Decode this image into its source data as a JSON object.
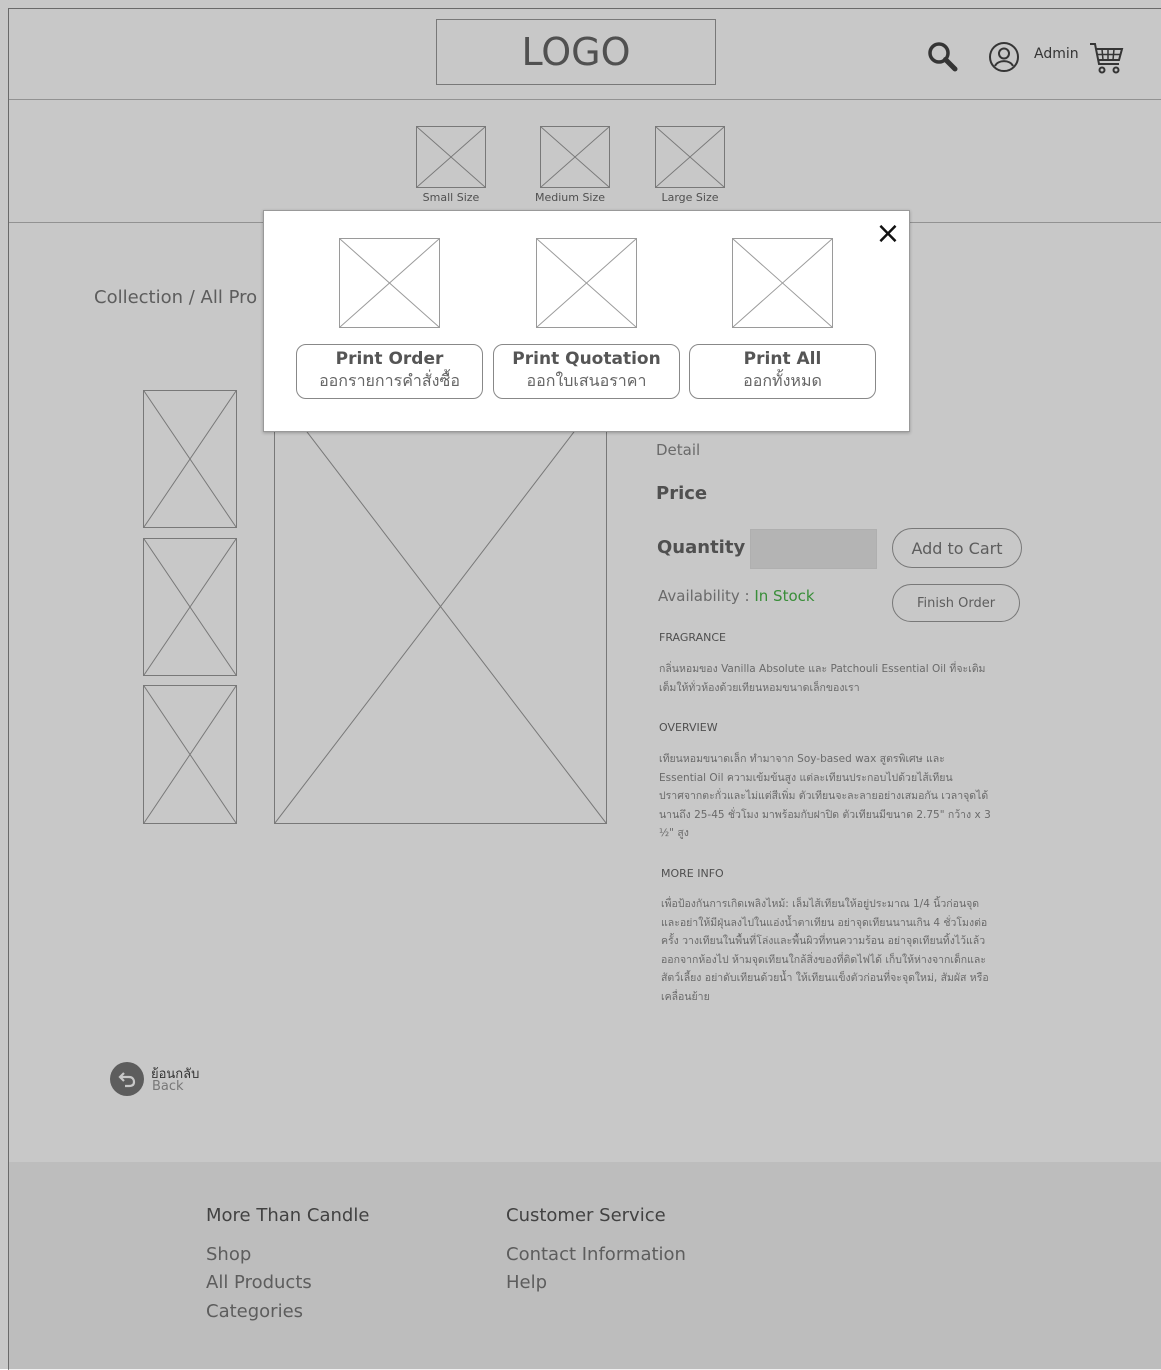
{
  "header": {
    "logo": "LOGO",
    "user_label": "Admin"
  },
  "sizes": [
    {
      "label": "Small Size"
    },
    {
      "label": "Medium Size"
    },
    {
      "label": "Large Size"
    }
  ],
  "breadcrumb": "Collection / All Pro",
  "product": {
    "detail": "Detail",
    "price": "Price",
    "quantity_label": "Quantity",
    "add_to_cart": "Add to Cart",
    "availability_label": "Availability : ",
    "availability_value": "In Stock",
    "finish_order": "Finish Order",
    "fragrance_h": "FRAGRANCE",
    "fragrance_t": "กลิ่นหอมของ Vanilla Absolute และ Patchouli Essential Oil ที่จะเติมเต็มให้ทั่วห้องด้วยเทียนหอมขนาดเล็กของเรา",
    "overview_h": "OVERVIEW",
    "overview_t": "เทียนหอมขนาดเล็ก ทำมาจาก Soy-based wax สูตรพิเศษ และ Essential Oil ความเข้มข้นสูง แต่ละเทียนประกอบไปด้วยไส้เทียนปราศจากตะกั่วและไม่แต่สีเพิ่ม ตัวเทียนจะละลายอย่างเสมอกัน เวลาจุดได้นานถึง 25-45 ชั่วโมง มาพร้อมกับฝาปิด ตัวเทียนมีขนาด 2.75\" กว้าง x 3 ½\" สูง",
    "moreinfo_h": "MORE INFO",
    "moreinfo_t": "เพื่อป้องกันการเกิดเพลิงไหม้: เล็มไส้เทียนให้อยู่ประมาณ 1/4 นิ้วก่อนจุด และอย่าให้มีฝุ่นลงไปในแอ่งน้ำตาเทียน อย่าจุดเทียนนานเกิน 4 ชั่วโมงต่อครั้ง วางเทียนในพื้นที่โล่งและพื้นผิวที่ทนความร้อน อย่าจุดเทียนทิ้งไว้แล้วออกจากห้องไป ห้ามจุดเทียนใกล้สิ่งของที่ติดไฟได้ เก็บให้ห่างจากเด็กและสัตว์เลี้ยง อย่าดับเทียนด้วยน้ำ ให้เทียนแข็งตัวก่อนที่จะจุดใหม่, สัมผัส หรือ เคลื่อนย้าย"
  },
  "back": {
    "th": "ย้อนกลับ",
    "en": "Back"
  },
  "footer": {
    "col1_title": "More Than Candle",
    "col1_links": [
      "Shop",
      "All Products",
      "Categories"
    ],
    "col2_title": "Customer Service",
    "col2_links": [
      "Contact Information",
      "Help"
    ]
  },
  "modal": {
    "close": "×",
    "buttons": [
      {
        "en": "Print Order",
        "th": "ออกรายการคำสั่งซื้อ"
      },
      {
        "en": "Print Quotation",
        "th": "ออกใบเสนอราคา"
      },
      {
        "en": "Print All",
        "th": "ออกทั้งหมด"
      }
    ]
  },
  "colors": {
    "in_stock": "#49b649",
    "overlay": "rgba(0,0,0,0.215)"
  }
}
